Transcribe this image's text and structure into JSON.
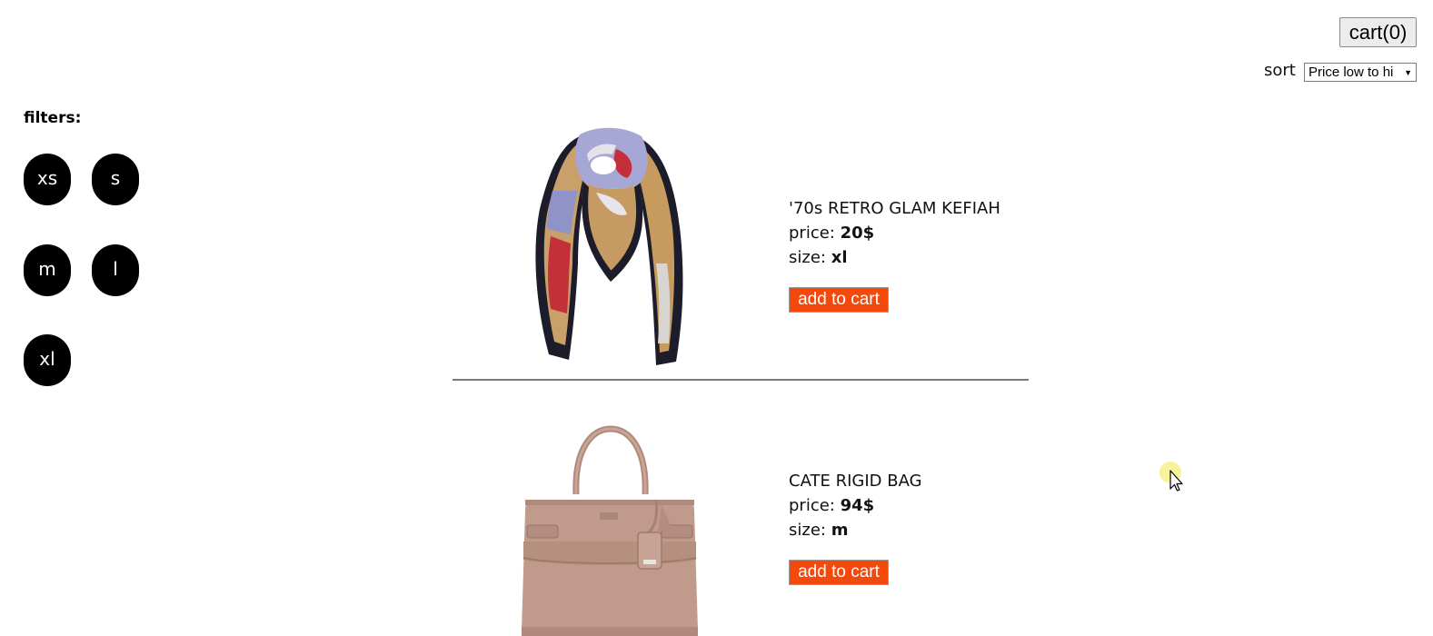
{
  "header": {
    "cart_label": "cart(0)",
    "sort_label": "sort",
    "sort_selected": "Price low to hi"
  },
  "filters": {
    "title": "filters:",
    "sizes": [
      "xs",
      "s",
      "m",
      "l",
      "xl"
    ]
  },
  "products": [
    {
      "name": "'70s RETRO GLAM KEFIAH",
      "price_label": "price:",
      "price": "20$",
      "size_label": "size:",
      "size": "xl",
      "button_label": "add to cart"
    },
    {
      "name": "CATE RIGID BAG",
      "price_label": "price:",
      "price": "94$",
      "size_label": "size:",
      "size": "m",
      "button_label": "add to cart"
    }
  ],
  "colors": {
    "add_button": "#f24a0c",
    "chip": "#000000",
    "bag": "#c09b8c"
  }
}
